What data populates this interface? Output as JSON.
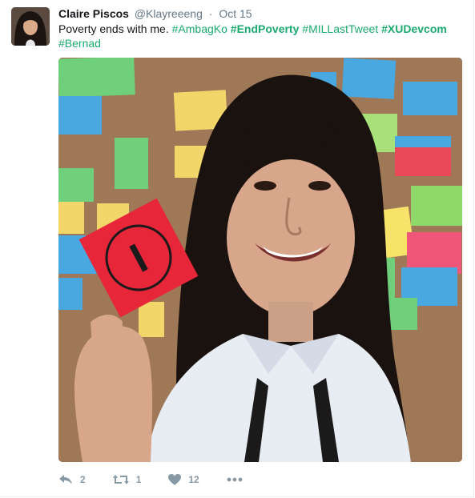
{
  "tweet": {
    "author_name": "Claire Piscos",
    "handle": "@Klayreeeng",
    "separator": "·",
    "date": "Oct 15",
    "text_plain": "Poverty ends with me.",
    "hashtags": [
      "#AmbagKo",
      "#EndPoverty",
      "#MILLastTweet",
      "#XUDevcom",
      "#Bernad"
    ],
    "photo_sign_text": "I"
  },
  "actions": {
    "reply_count": "2",
    "retweet_count": "1",
    "like_count": "12"
  },
  "colors": {
    "hashtag": "#1aaa6e",
    "meta": "#657786",
    "action_icon": "#8899a6"
  },
  "icons": [
    "reply-icon",
    "retweet-icon",
    "heart-icon",
    "more-icon"
  ]
}
